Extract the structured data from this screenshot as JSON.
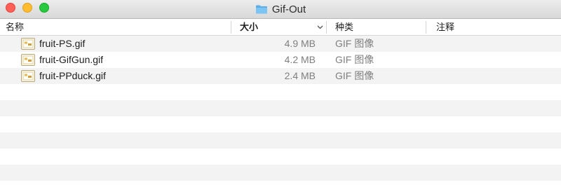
{
  "window": {
    "title": "Gif-Out"
  },
  "columns": {
    "name": "名称",
    "size": "大小",
    "kind": "种类",
    "notes": "注释"
  },
  "files": [
    {
      "name": "fruit-PS.gif",
      "size": "4.9 MB",
      "kind": "GIF 图像"
    },
    {
      "name": "fruit-GifGun.gif",
      "size": "4.2 MB",
      "kind": "GIF 图像"
    },
    {
      "name": "fruit-PPduck.gif",
      "size": "2.4 MB",
      "kind": "GIF 图像"
    }
  ],
  "colors": {
    "close": "#fe5f57",
    "minimize": "#febc2e",
    "zoom": "#28c840",
    "folder": "#6cb8f0",
    "stripe": "#f3f3f3"
  }
}
